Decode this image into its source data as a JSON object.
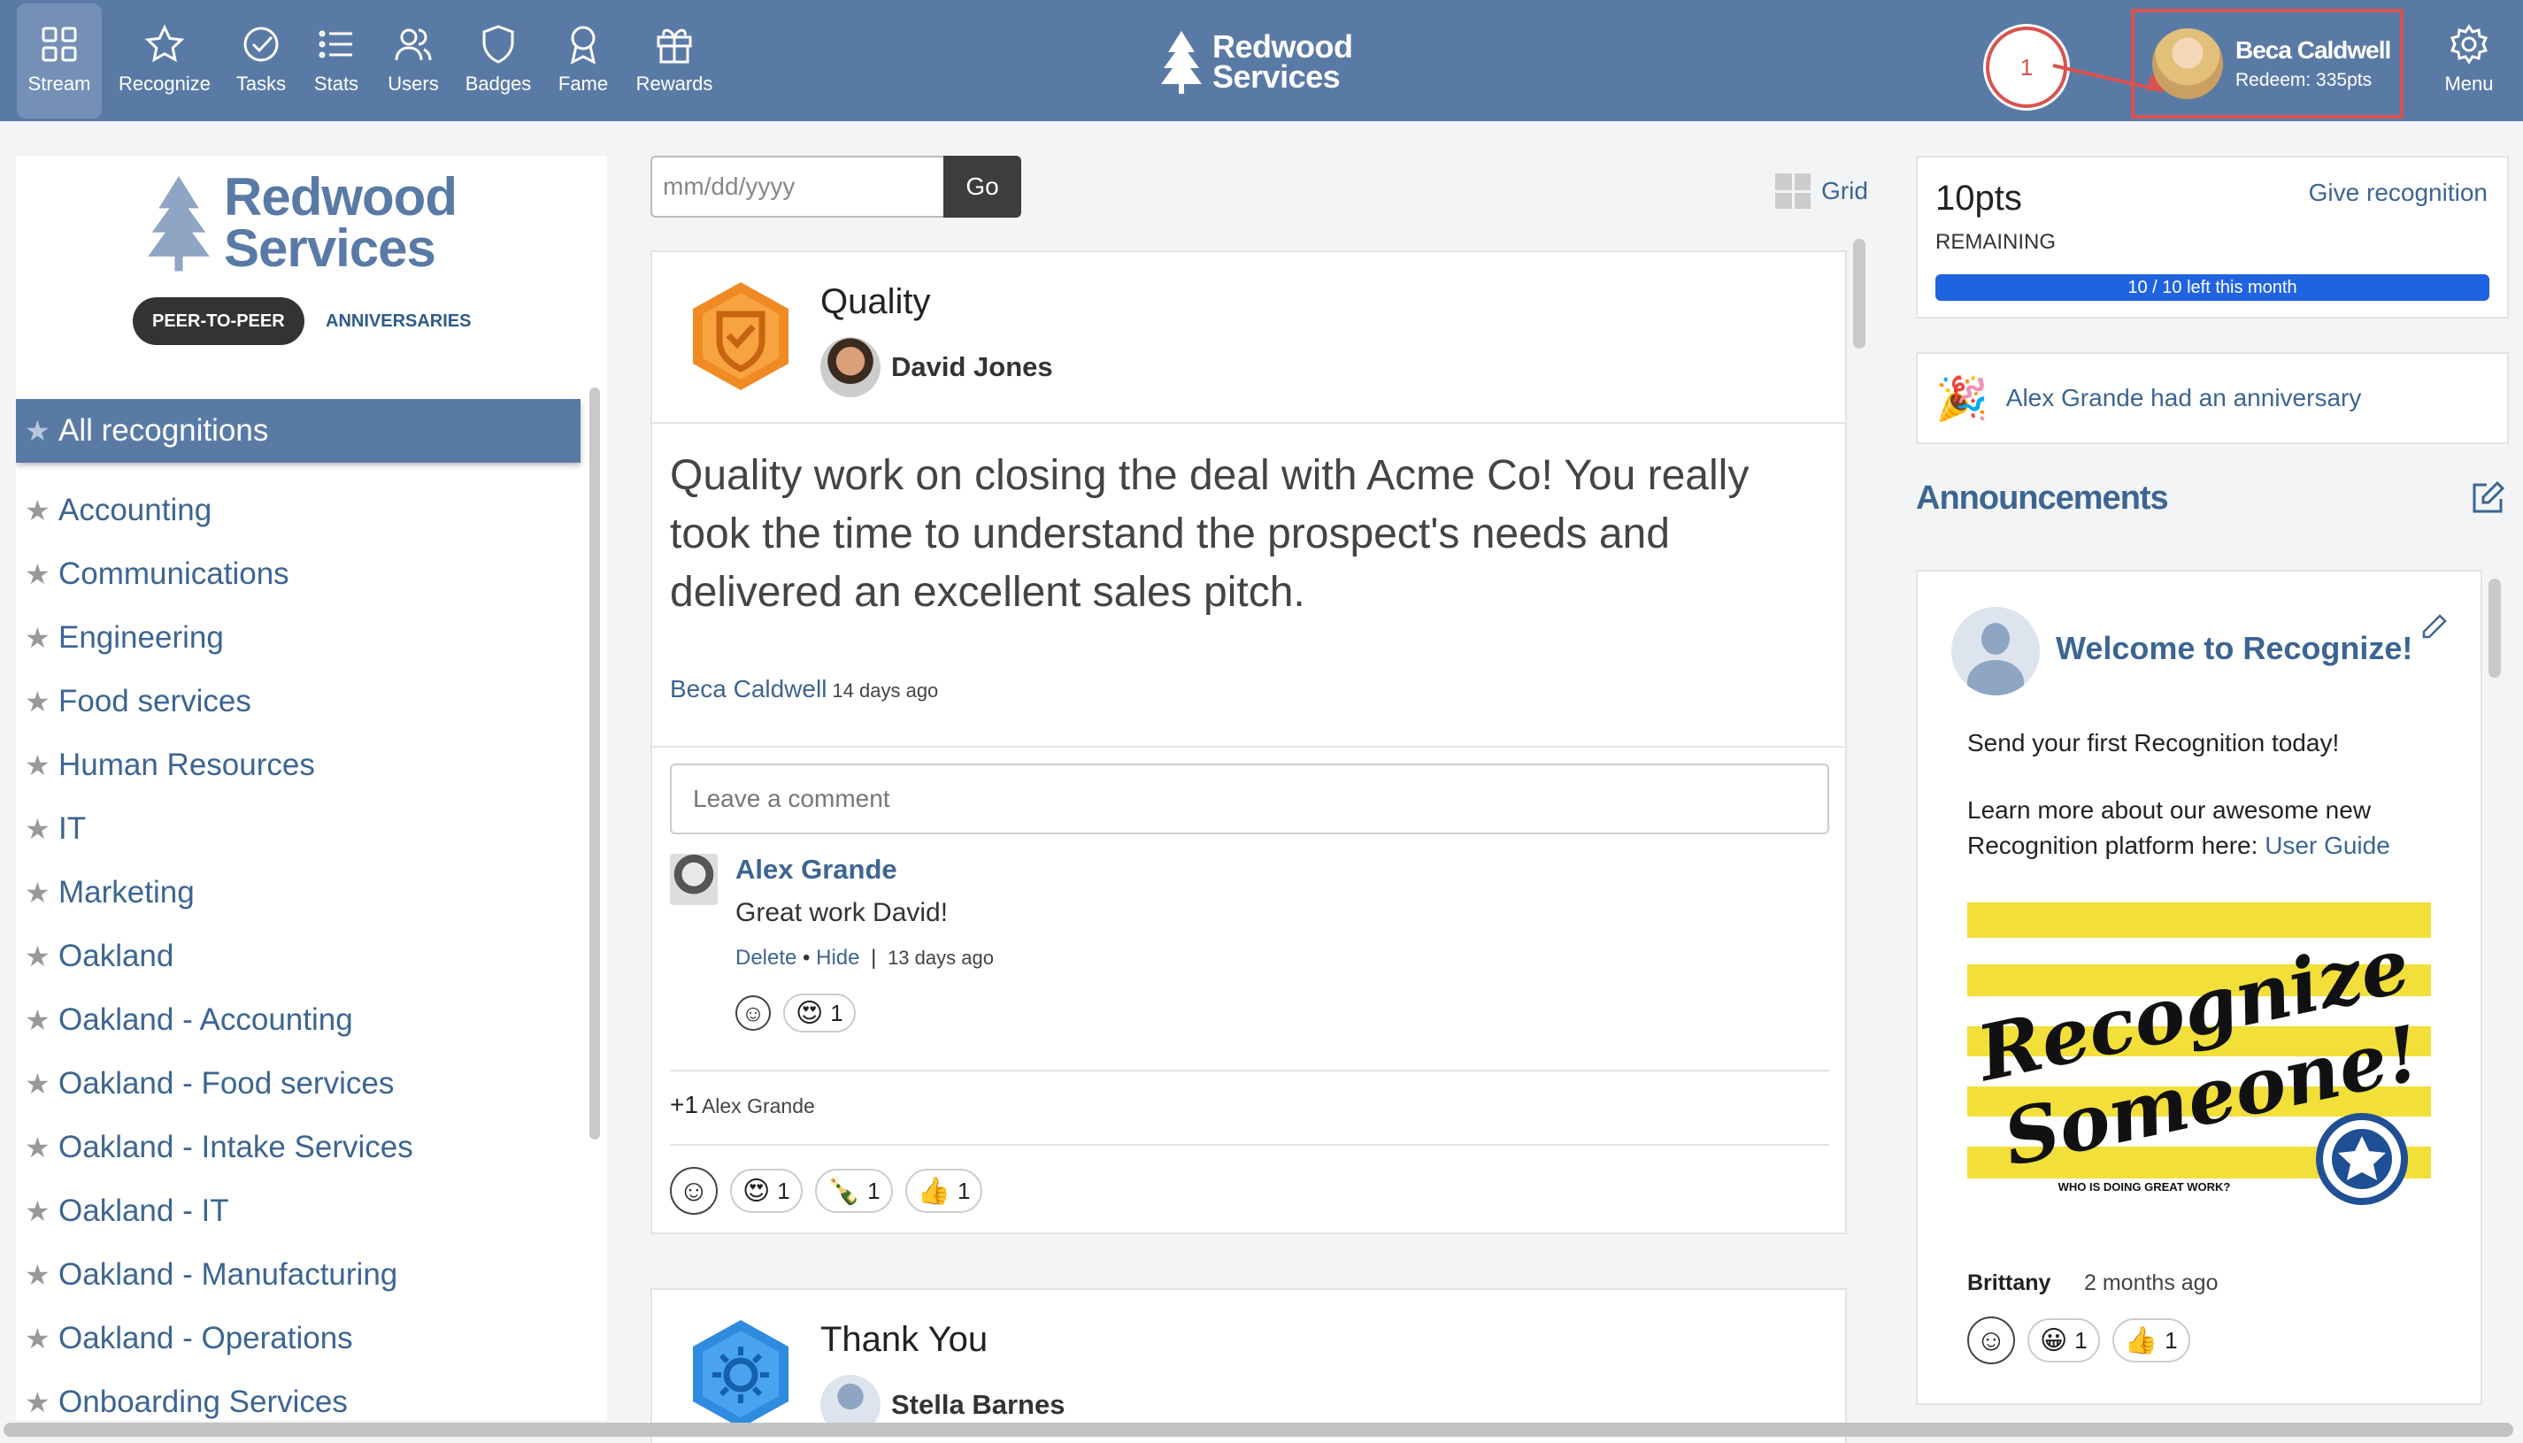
{
  "nav": {
    "items": [
      {
        "label": "Stream",
        "icon": "grid-icon"
      },
      {
        "label": "Recognize",
        "icon": "star-icon"
      },
      {
        "label": "Tasks",
        "icon": "check-circle-icon"
      },
      {
        "label": "Stats",
        "icon": "list-icon"
      },
      {
        "label": "Users",
        "icon": "users-icon"
      },
      {
        "label": "Badges",
        "icon": "shield-icon"
      },
      {
        "label": "Fame",
        "icon": "ribbon-icon"
      },
      {
        "label": "Rewards",
        "icon": "gift-icon"
      }
    ],
    "brand_line1": "Redwood",
    "brand_line2": "Services",
    "callout_number": "1",
    "user_name": "Beca Caldwell",
    "user_redeem": "Redeem: 335pts",
    "menu_label": "Menu"
  },
  "sidebar": {
    "brand_line1": "Redwood",
    "brand_line2": "Services",
    "tab_peer": "PEER-TO-PEER",
    "tab_anniversaries": "ANNIVERSARIES",
    "categories": [
      "All recognitions",
      "Accounting",
      "Communications",
      "Engineering",
      "Food services",
      "Human Resources",
      "IT",
      "Marketing",
      "Oakland",
      "Oakland - Accounting",
      "Oakland - Food services",
      "Oakland - Intake Services",
      "Oakland - IT",
      "Oakland - Manufacturing",
      "Oakland - Operations",
      "Onboarding Services"
    ]
  },
  "stream": {
    "date_placeholder": "mm/dd/yyyy",
    "go_label": "Go",
    "grid_label": "Grid",
    "card1": {
      "badge_title": "Quality",
      "recipient": "David Jones",
      "message": "Quality work on closing the deal with Acme Co! You really took the time to understand the prospect's needs and delivered an excellent sales pitch.",
      "sender": "Beca Caldwell",
      "sent_ago": "14 days ago",
      "comment_placeholder": "Leave a comment",
      "comment": {
        "author": "Alex Grande",
        "text": "Great work David!",
        "delete_label": "Delete",
        "bullet": "•",
        "hide_label": "Hide",
        "separator": "|",
        "ago": "13 days ago",
        "reactions": [
          {
            "emoji": "😍",
            "count": "1"
          }
        ]
      },
      "plus_one": "+1",
      "plus_one_user": "Alex Grande",
      "reactions": [
        {
          "emoji": "😍",
          "count": "1"
        },
        {
          "emoji": "🍾",
          "count": "1"
        },
        {
          "emoji": "👍",
          "count": "1"
        }
      ]
    },
    "card2": {
      "badge_title": "Thank You",
      "recipient": "Stella Barnes"
    }
  },
  "right": {
    "points": "10pts",
    "points_sub": "REMAINING",
    "give_link": "Give recognition",
    "bar_label": "10 / 10 left this month",
    "points_left_fraction": 1.0,
    "anniversary_text": "Alex Grande had an anniversary",
    "announcements_title": "Announcements",
    "announcement": {
      "title": "Welcome to Recognize!",
      "line1": "Send your first Recognition today!",
      "line2": "Learn more about our awesome new Recognition platform here:",
      "link": "User Guide",
      "image_text_1": "Recognize",
      "image_text_2": "Someone!",
      "image_caption": "WHO IS DOING GREAT WORK?",
      "author": "Brittany",
      "ago": "2 months ago",
      "reactions": [
        {
          "emoji": "😀",
          "count": "1"
        },
        {
          "emoji": "👍",
          "count": "1"
        }
      ]
    }
  },
  "colors": {
    "nav_bg": "#5a7aa6",
    "link": "#3c6593",
    "callout": "#d9534f",
    "progress": "#1f63e0",
    "badge_quality": "#f08a24",
    "badge_thanks": "#2f8be0"
  }
}
